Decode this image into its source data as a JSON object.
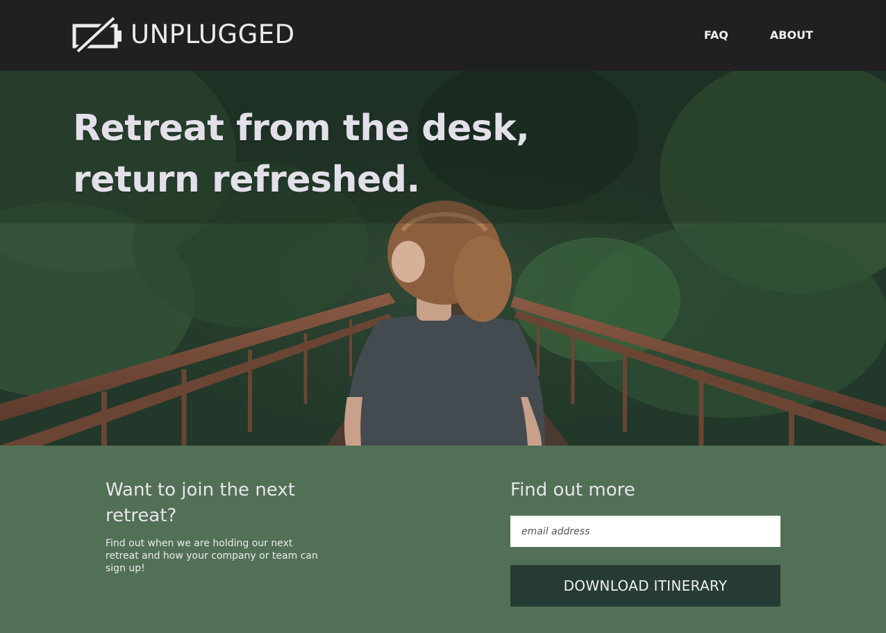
{
  "brand": {
    "name": "UNPLUGGED",
    "icon": "unplugged-battery-icon"
  },
  "nav": {
    "items": [
      {
        "label": "FAQ"
      },
      {
        "label": "ABOUT"
      }
    ]
  },
  "hero": {
    "title": "Retreat from the desk, return refreshed.",
    "image_alt": "Woman walking across a rusty footbridge in a forest"
  },
  "join": {
    "title": "Want to join the next retreat?",
    "text": "Find out when we are holding our next retreat and how your company or team can sign up!"
  },
  "signup": {
    "title": "Find out more",
    "email_placeholder": "email address",
    "button_label": "DOWNLOAD ITINERARY"
  },
  "colors": {
    "header_bg": "#202020",
    "section_bg": "#527055",
    "button_bg": "#263b34",
    "text_light": "#e6e4ec"
  }
}
